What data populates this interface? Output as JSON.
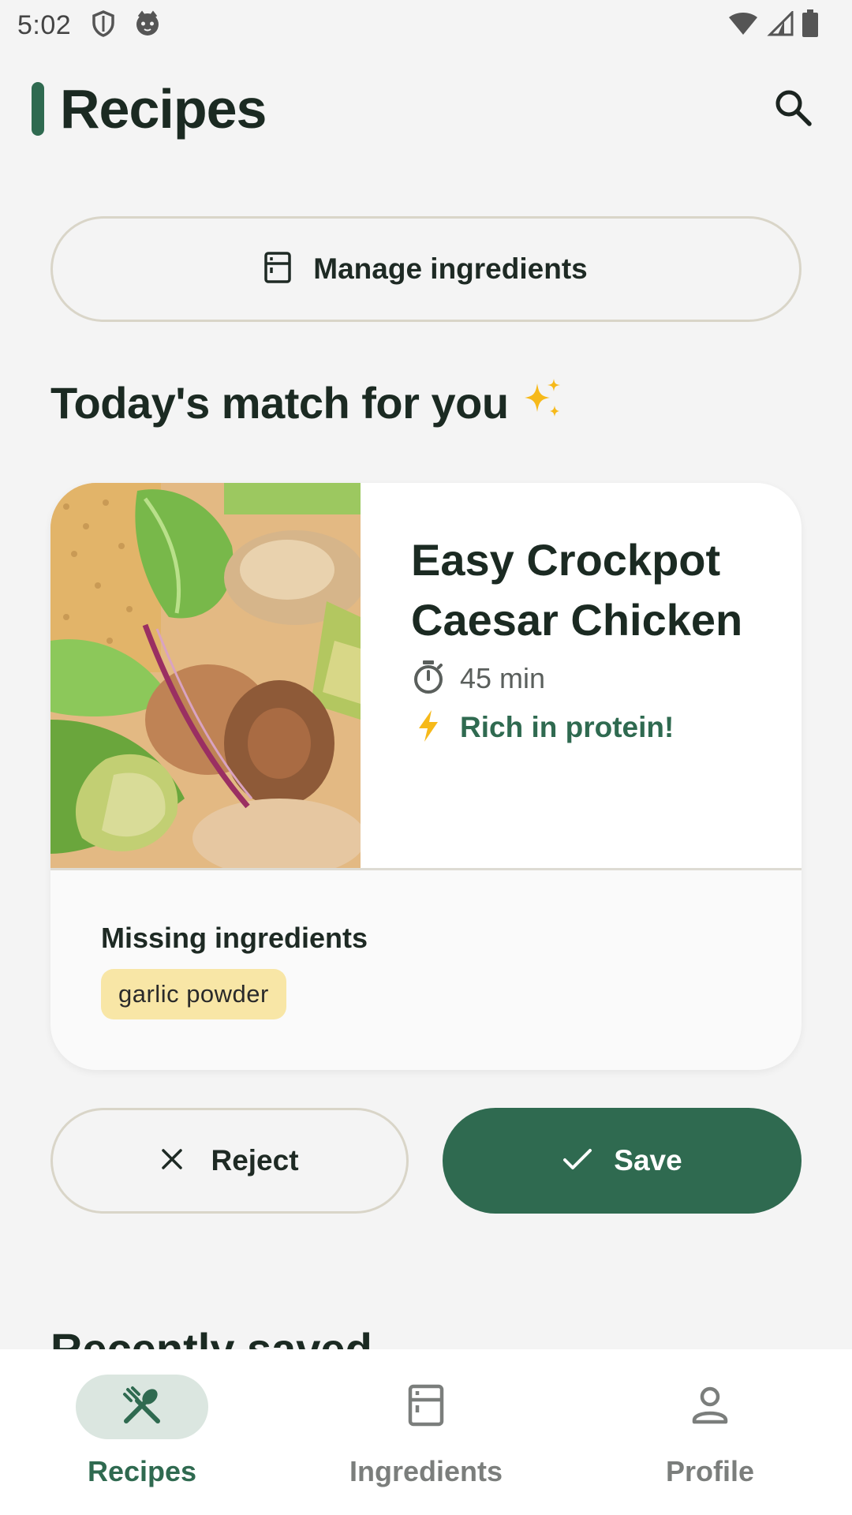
{
  "status_bar": {
    "time": "5:02",
    "icons": [
      "shield-icon",
      "cat-face-icon",
      "wifi-icon",
      "cellular-signal-icon",
      "battery-icon"
    ]
  },
  "header": {
    "title": "Recipes",
    "search_icon": "search-icon"
  },
  "manage_button": {
    "label": "Manage ingredients",
    "icon": "fridge-icon"
  },
  "section": {
    "title": "Today's match for you",
    "icon": "sparkles-icon"
  },
  "recipe_card": {
    "title": "Easy Crockpot Caesar Chicken",
    "time": "45 min",
    "time_icon": "timer-icon",
    "highlight": "Rich in protein!",
    "highlight_icon": "bolt-icon",
    "missing_title": "Missing ingredients",
    "missing_items": [
      "garlic powder"
    ]
  },
  "actions": {
    "reject_label": "Reject",
    "save_label": "Save"
  },
  "recent": {
    "title": "Recently saved"
  },
  "bottom_nav": {
    "items": [
      {
        "label": "Recipes",
        "icon": "fork-knife-icon",
        "active": true
      },
      {
        "label": "Ingredients",
        "icon": "fridge-icon",
        "active": false
      },
      {
        "label": "Profile",
        "icon": "person-icon",
        "active": false
      }
    ]
  },
  "colors": {
    "primary": "#2f6a50",
    "background": "#f4f4f4",
    "chip": "#f8e6a6",
    "accent_yellow": "#f6b91a"
  }
}
